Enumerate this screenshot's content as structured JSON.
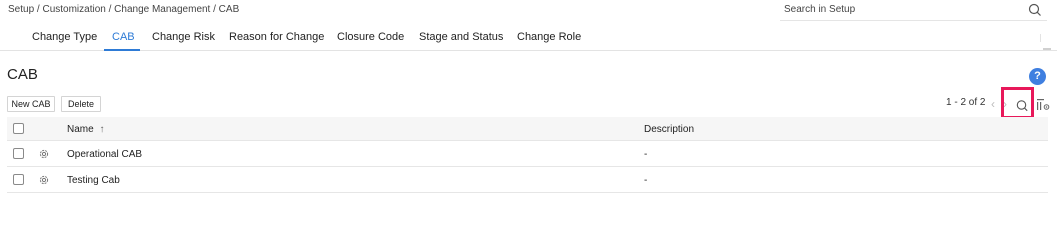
{
  "breadcrumb": "Setup / Customization / Change Management / CAB",
  "search": {
    "placeholder": "Search in Setup",
    "icon": "search-icon"
  },
  "tabs": [
    {
      "label": "Change Type",
      "active": false
    },
    {
      "label": "CAB",
      "active": true
    },
    {
      "label": "Change Risk",
      "active": false
    },
    {
      "label": "Reason for Change",
      "active": false
    },
    {
      "label": "Closure Code",
      "active": false
    },
    {
      "label": "Stage and Status",
      "active": false
    },
    {
      "label": "Change Role",
      "active": false
    }
  ],
  "page": {
    "title": "CAB",
    "help_label": "?"
  },
  "toolbar": {
    "new_label": "New CAB",
    "delete_label": "Delete",
    "pagination": "1 - 2 of 2",
    "prev_icon": "chevron-left-icon",
    "next_icon": "chevron-right-icon",
    "search_icon": "search-icon",
    "settings_icon": "column-settings-icon"
  },
  "table": {
    "columns": {
      "name": "Name",
      "sort_indicator": "↑",
      "description": "Description"
    },
    "rows": [
      {
        "name": "Operational CAB",
        "description": "-"
      },
      {
        "name": "Testing Cab",
        "description": "-"
      }
    ]
  },
  "colors": {
    "accent": "#2e7bd6",
    "highlight": "#e8185a",
    "help": "#3f7fe0"
  }
}
